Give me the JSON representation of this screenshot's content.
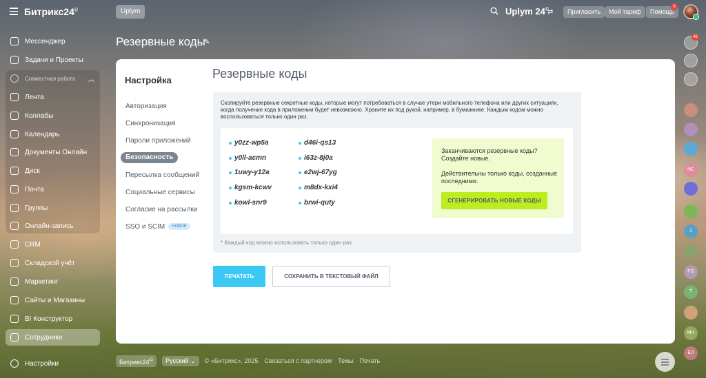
{
  "header": {
    "logo_text": "Битрикс24",
    "logo_mark": "©",
    "workspace_button": "Uplym",
    "portal_name": "Uplym 24",
    "portal_mark": "©",
    "invite_label": "Пригласить",
    "tariff_label": "Мой тариф",
    "help_label": "Помощь",
    "help_badge": "6"
  },
  "sidebar": {
    "items": [
      {
        "label": "Мессенджер",
        "icon": "messenger-icon"
      },
      {
        "label": "Задачи и Проекты",
        "icon": "tasks-icon"
      }
    ],
    "group_title": "Совместная работа",
    "group_items": [
      {
        "label": "Лента",
        "icon": "feed-icon"
      },
      {
        "label": "Коллабы",
        "icon": "collabs-icon"
      },
      {
        "label": "Календарь",
        "icon": "calendar-icon"
      },
      {
        "label": "Документы Онлайн",
        "icon": "documents-icon"
      },
      {
        "label": "Диск",
        "icon": "disk-icon"
      },
      {
        "label": "Почта",
        "icon": "mail-icon"
      },
      {
        "label": "Группы",
        "icon": "groups-icon"
      },
      {
        "label": "Онлайн-запись",
        "icon": "booking-icon"
      }
    ],
    "more_items": [
      {
        "label": "CRM",
        "icon": "crm-icon"
      },
      {
        "label": "Складской учёт",
        "icon": "inventory-icon"
      },
      {
        "label": "Маркетинг",
        "icon": "marketing-icon"
      },
      {
        "label": "Сайты и Магазины",
        "icon": "sites-icon"
      },
      {
        "label": "BI Конструктор",
        "icon": "bi-icon"
      },
      {
        "label": "Сотрудники",
        "icon": "employees-icon"
      }
    ],
    "settings_label": "Настройки"
  },
  "page": {
    "title": "Резервные коды"
  },
  "settings_menu": {
    "title": "Настройка",
    "items": [
      "Авторизация",
      "Синхронизация",
      "Пароли приложений",
      "Безопасность",
      "Пересылка сообщений",
      "Социальные сервисы",
      "Согласие на рассылки",
      "SSO и SCIM"
    ],
    "new_badge": "НОВОЕ"
  },
  "content": {
    "title": "Резервные коды",
    "description": "Скопируйте резервные секретные коды, которые могут потребоваться в случае утери мобильного телефона или других ситуациях, когда получение кода в приложении будет невозможно. Храните их под рукой, например, в бумажнике. Каждым кодом можно воспользоваться только один раз.",
    "codes_left": [
      "y0zz-wp5a",
      "y0ll-acmn",
      "1uwy-y12a",
      "kgsm-kcwv",
      "kowl-snr9"
    ],
    "codes_right": [
      "d46i-qs13",
      "i63z-8j0a",
      "e2wj-67yg",
      "m8dx-kxi4",
      "brwi-quty"
    ],
    "generate_text_1": "Заканчиваются резервные коды? Создайте новые.",
    "generate_text_2": "Действительны только коды, созданные последними.",
    "generate_button": "СГЕНЕРИРОВАТЬ НОВЫЕ КОДЫ",
    "footnote": "* Каждый код можно использовать только один раз.",
    "print_button": "ПЕЧАТАТЬ",
    "save_button": "СОХРАНИТЬ В ТЕКСТОВЫЙ ФАЙЛ"
  },
  "right_rail": {
    "notifications_badge": "48",
    "avatars": [
      "NC",
      "1",
      "FG",
      "T",
      "МЧ",
      "ЕЛ"
    ]
  },
  "footer": {
    "brand": "Битрикс24",
    "brand_mark": "©",
    "language": "Русский",
    "copyright": "© «Битрикс», 2025",
    "partner_link": "Связаться с партнером",
    "themes_link": "Темы",
    "print_link": "Печать"
  },
  "colors": {
    "accent_blue": "#3bc8f5",
    "accent_green": "#bbed21",
    "active_menu": "#7b8691",
    "badge_red": "#e0473a"
  }
}
